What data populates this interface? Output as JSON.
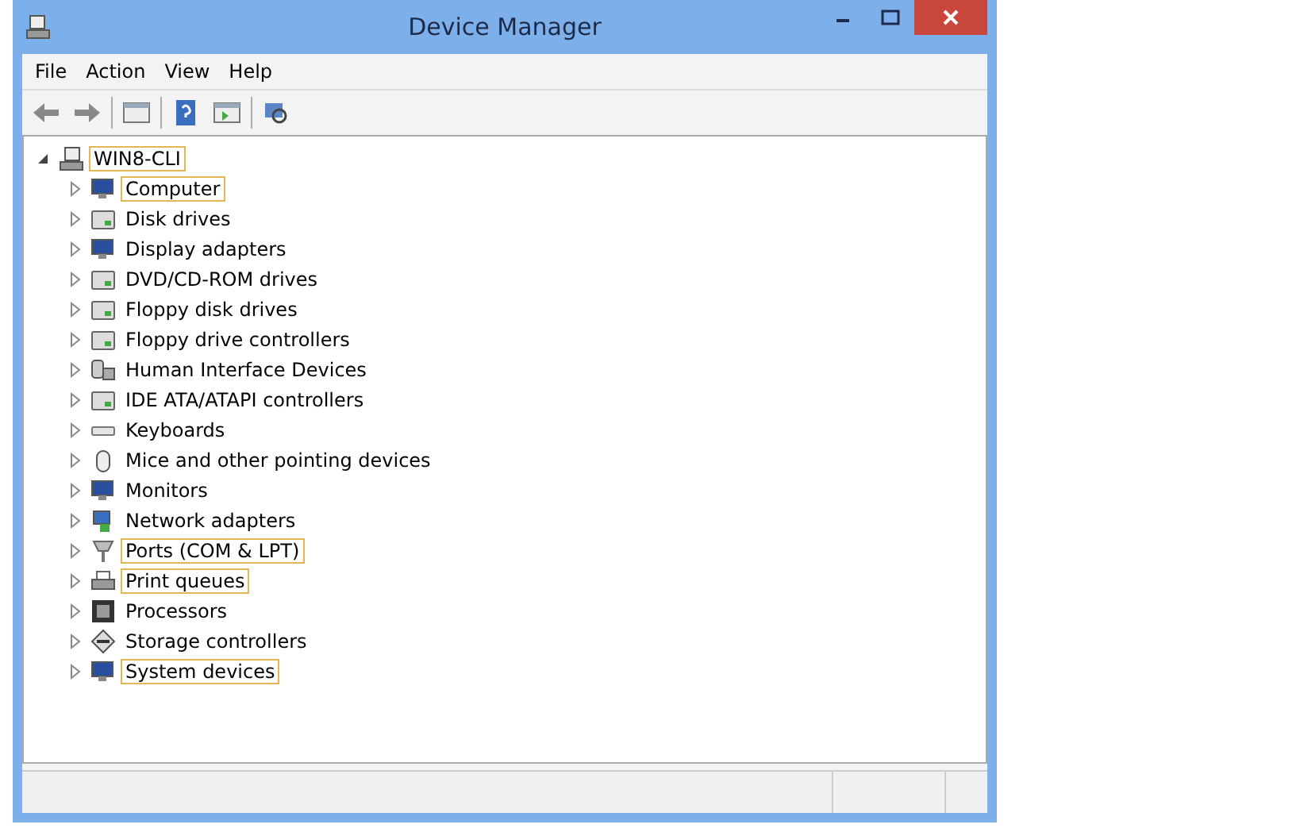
{
  "window": {
    "title": "Device Manager"
  },
  "menu": [
    "File",
    "Action",
    "View",
    "Help"
  ],
  "tree": {
    "label": "WIN8-CLI",
    "expanded": true,
    "highlighted": true,
    "children": [
      {
        "label": "Computer",
        "expanded": false,
        "highlighted": true
      },
      {
        "label": "Disk drives",
        "expanded": false,
        "highlighted": false
      },
      {
        "label": "Display adapters",
        "expanded": false,
        "highlighted": false
      },
      {
        "label": "DVD/CD-ROM drives",
        "expanded": false,
        "highlighted": false
      },
      {
        "label": "Floppy disk drives",
        "expanded": false,
        "highlighted": false
      },
      {
        "label": "Floppy drive controllers",
        "expanded": false,
        "highlighted": false
      },
      {
        "label": "Human Interface Devices",
        "expanded": false,
        "highlighted": false
      },
      {
        "label": "IDE ATA/ATAPI controllers",
        "expanded": false,
        "highlighted": false
      },
      {
        "label": "Keyboards",
        "expanded": false,
        "highlighted": false
      },
      {
        "label": "Mice and other pointing devices",
        "expanded": false,
        "highlighted": false
      },
      {
        "label": "Monitors",
        "expanded": false,
        "highlighted": false
      },
      {
        "label": "Network adapters",
        "expanded": false,
        "highlighted": false
      },
      {
        "label": "Ports (COM & LPT)",
        "expanded": false,
        "highlighted": true
      },
      {
        "label": "Print queues",
        "expanded": false,
        "highlighted": true
      },
      {
        "label": "Processors",
        "expanded": false,
        "highlighted": false
      },
      {
        "label": "Storage controllers",
        "expanded": false,
        "highlighted": false
      },
      {
        "label": "System devices",
        "expanded": false,
        "highlighted": true
      }
    ]
  }
}
